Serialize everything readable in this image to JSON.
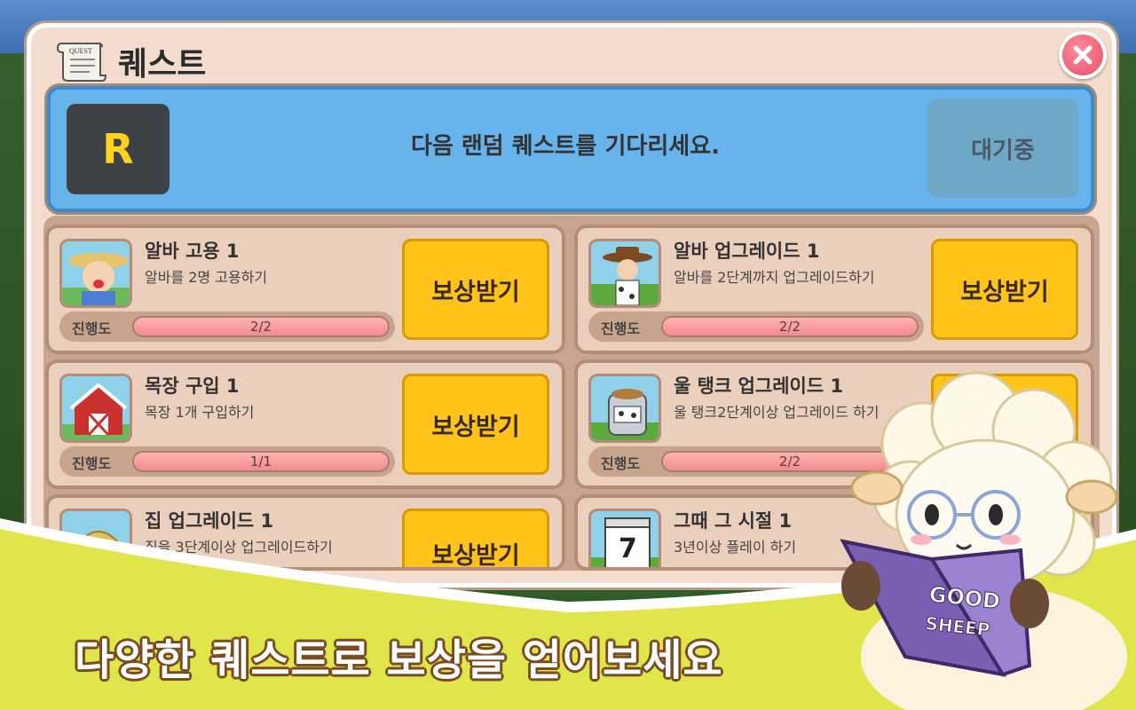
{
  "panel": {
    "title": "퀘스트",
    "scroll_icon_label": "QUEST",
    "close_icon": "close-x-icon"
  },
  "random_quest": {
    "badge": "R",
    "message": "다음 랜덤 퀘스트를 기다리세요.",
    "wait_label": "대기중"
  },
  "progress_label": "진행도",
  "reward_label": "보상받기",
  "quests": [
    {
      "title": "알바 고용 1",
      "desc": "알바를 2명 고용하기",
      "progress_text": "2/2",
      "progress": 1.0,
      "icon": "farmer-worker-icon"
    },
    {
      "title": "알바 업그레이드 1",
      "desc": "알바를 2단계까지 업그레이드하기",
      "progress_text": "2/2",
      "progress": 1.0,
      "icon": "cowboy-worker-icon"
    },
    {
      "title": "목장 구입 1",
      "desc": "목장 1개 구입하기",
      "progress_text": "1/1",
      "progress": 1.0,
      "icon": "barn-icon"
    },
    {
      "title": "울 탱크 업그레이드 1",
      "desc": "울 탱크2단계이상 업그레이드 하기",
      "progress_text": "2/2",
      "progress": 1.0,
      "icon": "wool-tank-icon"
    },
    {
      "title": "집 업그레이드 1",
      "desc": "집을 3단계이상 업그레이드하기",
      "progress_text": "",
      "progress": 1.0,
      "icon": "straw-house-icon"
    },
    {
      "title": "그때 그 시절 1",
      "desc": "3년이상 플레이 하기",
      "progress_text": "",
      "progress": 1.0,
      "icon": "calendar-icon"
    }
  ],
  "calendar_day": "7",
  "promo": {
    "headline": "다양한 퀘스트로 보상을 얻어보세요",
    "book_line1": "GOOD",
    "book_line2": "SHEEP"
  },
  "colors": {
    "panel_bg": "#f4ddce",
    "banner_blue": "#67b4ec",
    "reward_yellow": "#ffc31a",
    "progress_pink": "#f38a8e",
    "promo_green": "#dfe54a"
  }
}
